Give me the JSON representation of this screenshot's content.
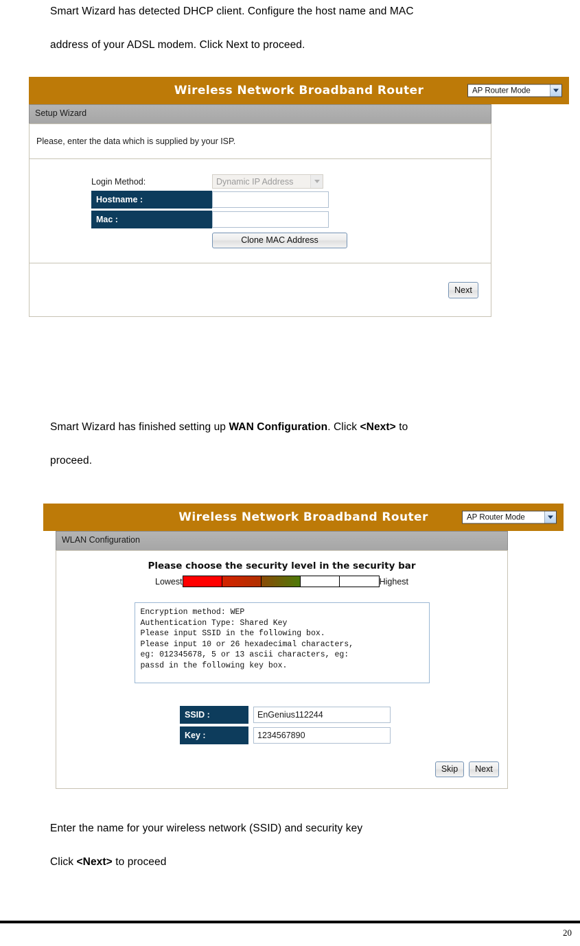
{
  "document": {
    "page_number": "20",
    "paragraphs": {
      "p1": "Smart Wizard has detected DHCP client. Configure the host name and MAC address of your ADSL modem. Click Next to proceed.",
      "p1_line1": "Smart Wizard has detected DHCP client. Configure the host name and MAC",
      "p1_line2": "address of your ADSL modem. Click Next to proceed.",
      "p2_a": "Smart Wizard has finished setting up ",
      "p2_b": "WAN Configuration",
      "p2_c": ". Click ",
      "p2_d": "<Next>",
      "p2_e": " to",
      "p2_f": "proceed.",
      "p3_line1": "Enter the name for your wireless network (SSID) and security key",
      "p3_a": "Click ",
      "p3_b": "<Next>",
      "p3_c": " to proceed"
    }
  },
  "colors": {
    "gold_header": "#bd7a08",
    "dark_label": "#0d3c5c",
    "section_gray": "#b0b0b0",
    "security_lowest": "#ff0000",
    "security_low": "#cc2200",
    "security_mid_start": "#8a4a06",
    "security_mid_end": "#4d7a09",
    "security_empty": "#ffffff"
  },
  "screenshot1": {
    "header": {
      "title": "Wireless Network Broadband Router",
      "mode_select": {
        "value": "AP Router Mode",
        "icon": "chevron-down-icon"
      }
    },
    "section_title": "Setup Wizard",
    "intro": "Please, enter the data which is supplied by your ISP.",
    "form": {
      "login_method_label": "Login Method:",
      "login_method_value": "Dynamic IP Address",
      "hostname_label": "Hostname :",
      "hostname_value": "",
      "hostname_placeholder": "",
      "mac_label": "Mac :",
      "mac_value": "",
      "mac_placeholder": "",
      "clone_button": "Clone MAC Address"
    },
    "footer_buttons": {
      "next": "Next"
    }
  },
  "screenshot2": {
    "header": {
      "title": "Wireless Network Broadband Router",
      "mode_select": {
        "value": "AP Router Mode",
        "icon": "chevron-down-icon"
      }
    },
    "section_title": "WLAN Configuration",
    "security": {
      "heading": "Please choose the security level in the security bar",
      "label_lowest": "Lowest",
      "label_highest": "Highest",
      "segments": 5,
      "filled_segments": 3
    },
    "info_text": "Encryption method: WEP\nAuthentication Type: Shared Key\nPlease input SSID in the following box.\nPlease input 10 or 26 hexadecimal characters,\neg: 012345678, 5 or 13 ascii characters, eg:\npassd in the following key box.",
    "form": {
      "ssid_label": "SSID :",
      "ssid_value": "EnGenius112244",
      "key_label": "Key :",
      "key_value": "1234567890"
    },
    "footer_buttons": {
      "skip": "Skip",
      "next": "Next"
    }
  }
}
